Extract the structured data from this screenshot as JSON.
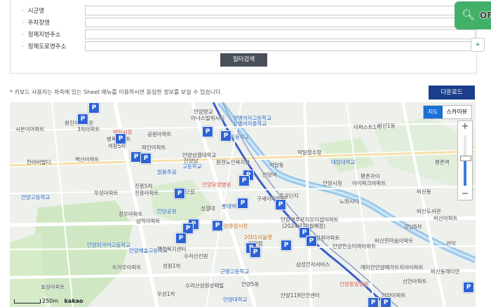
{
  "filters": {
    "fields": [
      {
        "label": "시군명"
      },
      {
        "label": "주차장명"
      },
      {
        "label": "정제지번주소"
      },
      {
        "label": "정제도로명주소"
      }
    ],
    "search_button": "필터검색"
  },
  "note": "* 키보드 사용자는 좌측에 있는 Sheet 메뉴를 이용하시면 동일한 정보를 보실 수 있습니다.",
  "download_button": "다운로드",
  "search_fab": {
    "label": "OF",
    "icon": "search-icon"
  },
  "map": {
    "type_buttons": [
      "지도",
      "스카이뷰"
    ],
    "zoom_plus": "+",
    "zoom_minus": "−",
    "zoom_level_fraction": 0.55,
    "scale": "250m",
    "provider": "kakao",
    "pin_label": "P",
    "labels": [
      {
        "text": "안양향교",
        "c": ""
      },
      {
        "text": "아너스빌위시티",
        "c": ""
      },
      {
        "text": "양명여자고등학교",
        "c": "blue"
      },
      {
        "text": "양명여자중학교",
        "c": "blue"
      },
      {
        "text": "양명고등학교",
        "c": "blue"
      },
      {
        "text": "시온이아파트",
        "c": ""
      },
      {
        "text": "원진이스타운",
        "c": ""
      },
      {
        "text": "3차아파트",
        "c": ""
      },
      {
        "text": "병목아파트",
        "c": ""
      },
      {
        "text": "박달시장",
        "c": "red"
      },
      {
        "text": "공원아파트",
        "c": ""
      },
      {
        "text": "한라비발디",
        "c": ""
      },
      {
        "text": "벽산아파트",
        "c": ""
      },
      {
        "text": "파인아파트",
        "c": ""
      },
      {
        "text": "석장5차",
        "c": ""
      },
      {
        "text": "안양성결대학교",
        "c": ""
      },
      {
        "text": "안양남",
        "c": ""
      },
      {
        "text": "고등학교",
        "c": "blue"
      },
      {
        "text": "원현노인복지관",
        "c": ""
      },
      {
        "text": "알몸주공",
        "c": "blue"
      },
      {
        "text": "안양요양병원",
        "c": "red"
      },
      {
        "text": "롯데백화점",
        "c": "blue"
      },
      {
        "text": "박달동",
        "c": ""
      },
      {
        "text": "박달정수장",
        "c": ""
      },
      {
        "text": "대림대학교",
        "c": "blue"
      },
      {
        "text": "안양역",
        "c": ""
      },
      {
        "text": "안양고등학교",
        "c": "blue"
      },
      {
        "text": "댈리단길",
        "c": ""
      },
      {
        "text": "우성아파트",
        "c": ""
      },
      {
        "text": "진흥5차",
        "c": ""
      },
      {
        "text": "진흥아파트",
        "c": ""
      },
      {
        "text": "구세이아파트",
        "c": ""
      },
      {
        "text": "주공단지",
        "c": ""
      },
      {
        "text": "안양시청",
        "c": ""
      },
      {
        "text": "평촌자이",
        "c": ""
      },
      {
        "text": "아이파크아파트",
        "c": ""
      },
      {
        "text": "더퍼스트1차",
        "c": ""
      },
      {
        "text": "비산1동",
        "c": ""
      },
      {
        "text": "정우아파트",
        "c": ""
      },
      {
        "text": "삼익아파트",
        "c": ""
      },
      {
        "text": "안양공원",
        "c": "blue"
      },
      {
        "text": "성결대",
        "c": ""
      },
      {
        "text": "안양중앙시장",
        "c": "orange"
      },
      {
        "text": "안양역푸르지오더샵아파트",
        "c": ""
      },
      {
        "text": "(2024년10월예정)",
        "c": ""
      },
      {
        "text": "비산동",
        "c": ""
      },
      {
        "text": "비산도서관",
        "c": ""
      },
      {
        "text": "강남6차",
        "c": ""
      },
      {
        "text": "안양예술고등학교",
        "c": "blue"
      },
      {
        "text": "안양외국어고등학교",
        "c": "blue"
      },
      {
        "text": "행정복지센터",
        "c": ""
      },
      {
        "text": "2001아울렛",
        "c": "orange"
      },
      {
        "text": "안양점",
        "c": ""
      },
      {
        "text": "성원아파트",
        "c": ""
      },
      {
        "text": "안양한승미래아파트",
        "c": ""
      },
      {
        "text": "비산한마음아파트",
        "c": ""
      },
      {
        "text": "수리산선원",
        "c": ""
      },
      {
        "text": "트라우아파트",
        "c": ""
      },
      {
        "text": "성원1차",
        "c": ""
      },
      {
        "text": "근명고등학교",
        "c": "blue"
      },
      {
        "text": "삼성전자서비스",
        "c": ""
      },
      {
        "text": "래미안안양메가트리아아파트",
        "c": ""
      },
      {
        "text": "비산동래미안",
        "c": ""
      },
      {
        "text": "안양5동",
        "c": ""
      },
      {
        "text": "안양119안전센터",
        "c": ""
      },
      {
        "text": "안양중앙병원",
        "c": "red"
      },
      {
        "text": "효성아파트",
        "c": ""
      },
      {
        "text": "우성1차",
        "c": ""
      },
      {
        "text": "수리산성원상떼빌",
        "c": ""
      },
      {
        "text": "안양대학교",
        "c": "blue"
      },
      {
        "text": "안양아파트",
        "c": ""
      },
      {
        "text": "관악",
        "c": ""
      },
      {
        "text": "평촌역",
        "c": ""
      },
      {
        "text": "비산아파트",
        "c": ""
      },
      {
        "text": "노와시티",
        "c": ""
      },
      {
        "text": "신안아파트",
        "c": ""
      }
    ]
  }
}
